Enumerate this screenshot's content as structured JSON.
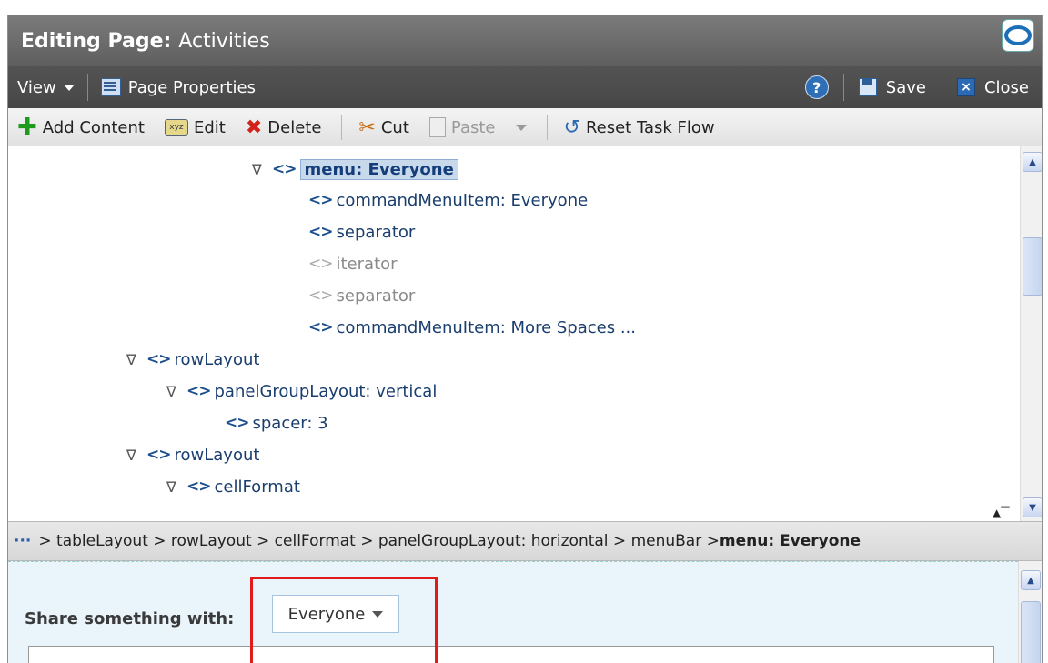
{
  "title": {
    "prefix": "Editing Page:",
    "page": "Activities"
  },
  "viewbar": {
    "view_label": "View",
    "page_properties": "Page Properties",
    "help": "?",
    "save": "Save",
    "close": "Close"
  },
  "toolbar": {
    "add_content": "Add Content",
    "edit": "Edit",
    "edit_icon_text": "xyz",
    "delete": "Delete",
    "cut": "Cut",
    "paste": "Paste",
    "reset_task_flow": "Reset Task Flow"
  },
  "tree": {
    "tag_glyph": "<>",
    "expander": "∇",
    "items": [
      {
        "label": "menu: Everyone",
        "expanded": true,
        "selected": true,
        "hidden": false
      },
      {
        "label": "commandMenuItem: Everyone",
        "expanded": false,
        "selected": false,
        "hidden": false
      },
      {
        "label": "separator",
        "expanded": false,
        "selected": false,
        "hidden": false
      },
      {
        "label": "iterator",
        "expanded": false,
        "selected": false,
        "hidden": true
      },
      {
        "label": "separator",
        "expanded": false,
        "selected": false,
        "hidden": true
      },
      {
        "label": "commandMenuItem: More Spaces ...",
        "expanded": false,
        "selected": false,
        "hidden": false
      },
      {
        "label": "rowLayout",
        "expanded": true,
        "selected": false,
        "hidden": false
      },
      {
        "label": "panelGroupLayout: vertical",
        "expanded": true,
        "selected": false,
        "hidden": false
      },
      {
        "label": "spacer: 3",
        "expanded": false,
        "selected": false,
        "hidden": false
      },
      {
        "label": "rowLayout",
        "expanded": true,
        "selected": false,
        "hidden": false
      },
      {
        "label": "cellFormat",
        "expanded": true,
        "selected": false,
        "hidden": false
      }
    ]
  },
  "breadcrumb": {
    "dots": "···",
    "path": " > tableLayout > rowLayout > cellFormat > panelGroupLayout: horizontal > menuBar > ",
    "current": "menu: Everyone"
  },
  "preview": {
    "share_label": "Share something with:",
    "dropdown_value": "Everyone"
  },
  "colors": {
    "highlight_box": "#e01b1b",
    "selected_node": "#c9d9ec"
  }
}
